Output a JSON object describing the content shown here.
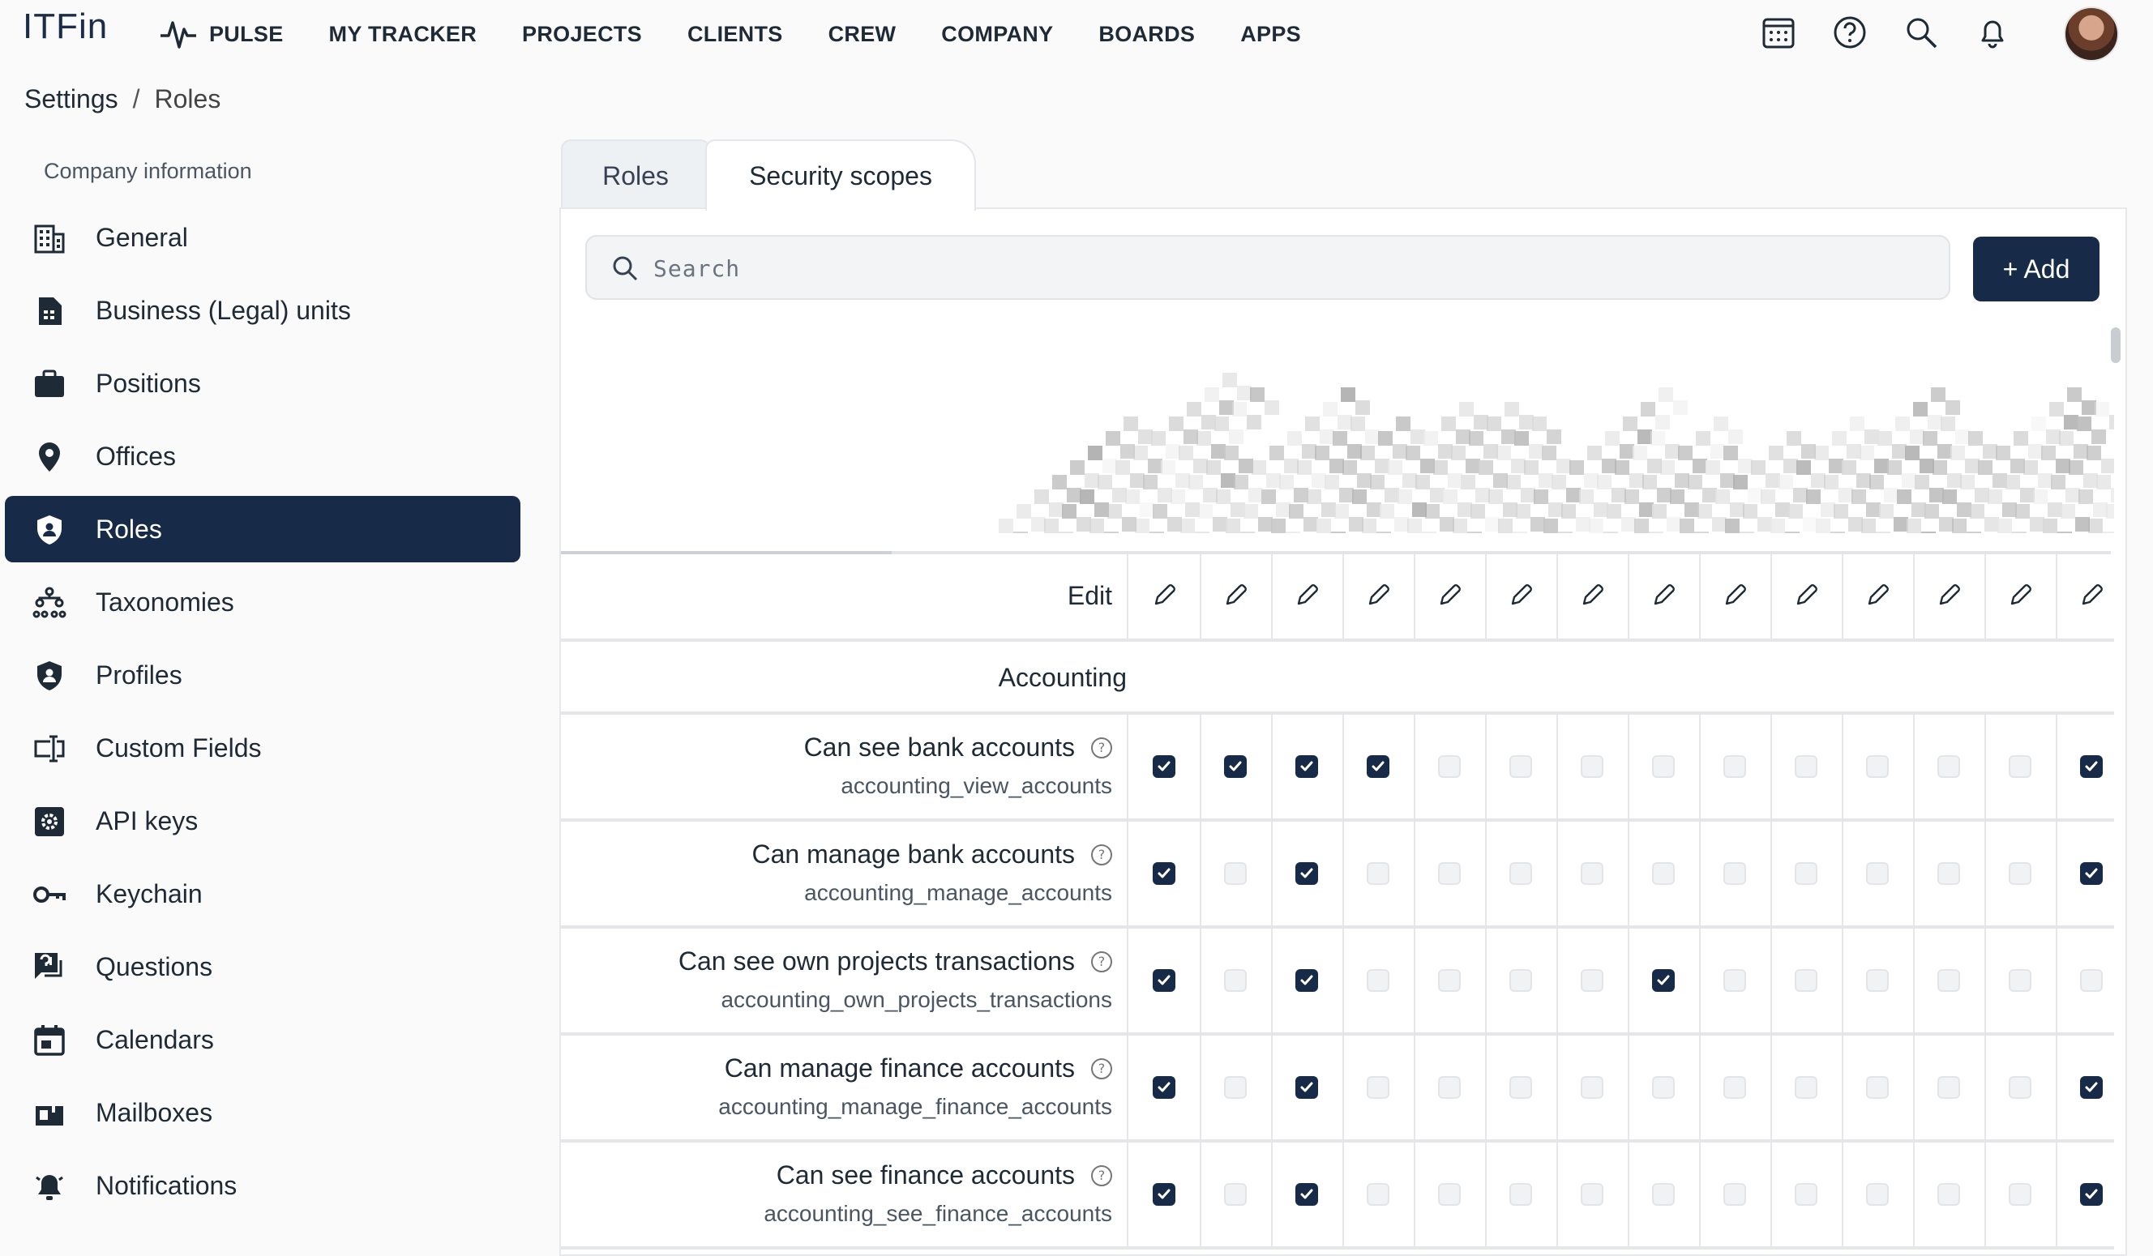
{
  "app": {
    "logo": "ITFin",
    "nav": [
      "PULSE",
      "MY TRACKER",
      "PROJECTS",
      "CLIENTS",
      "CREW",
      "COMPANY",
      "BOARDS",
      "APPS"
    ]
  },
  "breadcrumb": {
    "parent": "Settings",
    "separator": "/",
    "current": "Roles"
  },
  "sidebar": {
    "section": "Company information",
    "items": [
      {
        "label": "General",
        "icon": "building-icon"
      },
      {
        "label": "Business (Legal) units",
        "icon": "document-icon"
      },
      {
        "label": "Positions",
        "icon": "briefcase-icon"
      },
      {
        "label": "Offices",
        "icon": "location-pin-icon"
      },
      {
        "label": "Roles",
        "icon": "shield-user-icon",
        "active": true
      },
      {
        "label": "Taxonomies",
        "icon": "hierarchy-icon"
      },
      {
        "label": "Profiles",
        "icon": "shield-user-icon"
      },
      {
        "label": "Custom Fields",
        "icon": "custom-field-icon"
      },
      {
        "label": "API keys",
        "icon": "gear-box-icon"
      },
      {
        "label": "Keychain",
        "icon": "key-icon"
      },
      {
        "label": "Questions",
        "icon": "question-chat-icon"
      },
      {
        "label": "Calendars",
        "icon": "calendar-icon"
      },
      {
        "label": "Mailboxes",
        "icon": "mailbox-icon"
      },
      {
        "label": "Notifications",
        "icon": "bell-icon"
      }
    ]
  },
  "tabs": {
    "roles": "Roles",
    "scopes": "Security scopes"
  },
  "search": {
    "placeholder": "Search"
  },
  "add_button": "+ Add",
  "table": {
    "edit_label": "Edit",
    "section": "Accounting",
    "rows": [
      {
        "name": "Can see bank accounts",
        "code": "accounting_view_accounts",
        "checks": [
          1,
          1,
          1,
          1,
          0,
          0,
          0,
          0,
          0,
          0,
          0,
          0,
          0,
          1
        ]
      },
      {
        "name": "Can manage bank accounts",
        "code": "accounting_manage_accounts",
        "checks": [
          1,
          0,
          1,
          0,
          0,
          0,
          0,
          0,
          0,
          0,
          0,
          0,
          0,
          1
        ]
      },
      {
        "name": "Can see own projects transactions",
        "code": "accounting_own_projects_transactions",
        "checks": [
          1,
          0,
          1,
          0,
          0,
          0,
          0,
          1,
          0,
          0,
          0,
          0,
          0,
          0
        ]
      },
      {
        "name": "Can manage finance accounts",
        "code": "accounting_manage_finance_accounts",
        "checks": [
          1,
          0,
          1,
          0,
          0,
          0,
          0,
          0,
          0,
          0,
          0,
          0,
          0,
          1
        ]
      },
      {
        "name": "Can see finance accounts",
        "code": "accounting_see_finance_accounts",
        "checks": [
          1,
          0,
          1,
          0,
          0,
          0,
          0,
          0,
          0,
          0,
          0,
          0,
          0,
          1
        ]
      }
    ]
  },
  "colors": {
    "accent": "#172b49",
    "checkbox_off": "#f1f2f4"
  }
}
